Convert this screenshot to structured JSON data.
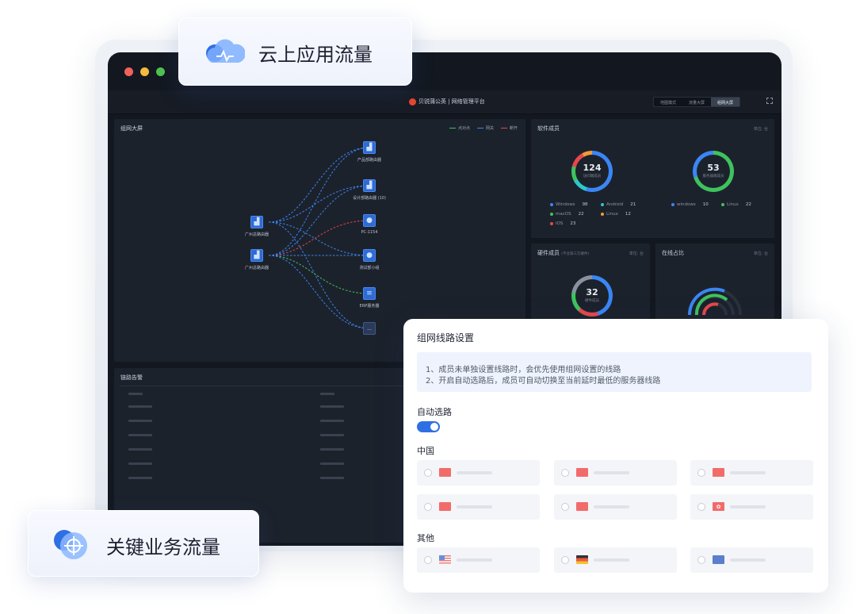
{
  "window": {
    "traffic_lights": [
      "#f0625a",
      "#f4b93f",
      "#4fc14f"
    ]
  },
  "header": {
    "brand": "贝锐蒲公英 | 网络管理平台",
    "tabs": [
      "地图模式",
      "流量大屏",
      "组网大屏"
    ],
    "active_tab": "组网大屏"
  },
  "network_panel": {
    "title": "组网大屏",
    "legend": [
      {
        "label": "点对点",
        "color": "#3ec25e"
      },
      {
        "label": "网关",
        "color": "#3a86f5"
      },
      {
        "label": "断开",
        "color": "#e5484d"
      }
    ],
    "sources": [
      "广州总路由器",
      "广州总路由器"
    ],
    "targets": [
      "产品部路由器",
      "设计部路由器 (10)",
      "PC-1154",
      "测试部小组",
      "ERP服务器",
      "..."
    ]
  },
  "software_panel": {
    "title": "软件成员",
    "unit": "单位: 台",
    "ring1": {
      "value": "124",
      "label": "访问端成员"
    },
    "ring2": {
      "value": "53",
      "label": "服务器端成员"
    },
    "left_items": [
      {
        "name": "Windows",
        "count": "98",
        "color": "#3a86f5"
      },
      {
        "name": "Android",
        "count": "21",
        "color": "#2dc8c8"
      },
      {
        "name": "macOS",
        "count": "22",
        "color": "#3ec25e"
      },
      {
        "name": "Linux",
        "count": "12",
        "color": "#f29a3a"
      },
      {
        "name": "iOS",
        "count": "23",
        "color": "#e5484d"
      }
    ],
    "right_items": [
      {
        "name": "windows",
        "count": "10",
        "color": "#3a86f5"
      },
      {
        "name": "Linux",
        "count": "22",
        "color": "#3ec25e"
      }
    ]
  },
  "hardware_panel": {
    "title": "硬件成员",
    "note": "(不含第三方硬件)",
    "unit": "单位: 台",
    "ring": {
      "value": "32",
      "label": "硬件成员"
    }
  },
  "online_panel": {
    "title": "在线占比",
    "unit": "单位: 台"
  },
  "alert_panel": {
    "title": "链路告警"
  },
  "chips": {
    "cloud": "云上应用流量",
    "business": "关键业务流量"
  },
  "route_card": {
    "title": "组网线路设置",
    "info_lines": [
      "1、成员未单独设置线路时，会优先使用组网设置的线路",
      "2、开启自动选路后，成员可自动切换至当前延时最低的服务器线路"
    ],
    "auto_label": "自动选路",
    "auto_enabled": true,
    "china_label": "中国",
    "other_label": "其他",
    "china_flags": [
      "cn",
      "cn",
      "cn",
      "cn",
      "cn",
      "hk"
    ],
    "other_flags": [
      "us",
      "de",
      "au"
    ]
  }
}
